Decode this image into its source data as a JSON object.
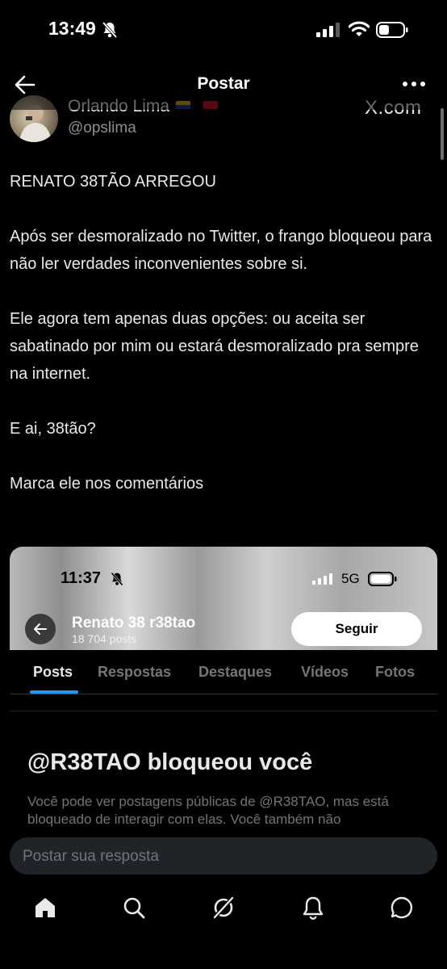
{
  "status_bar": {
    "time": "13:49"
  },
  "header": {
    "title": "Postar"
  },
  "embedded_author": {
    "name": "Orlando Lima",
    "handle": "@opslima",
    "site": "X.com"
  },
  "post": {
    "paragraphs": [
      "RENATO 38TÃO ARREGOU",
      "Após ser desmoralizado no Twitter, o frango bloqueou para não ler verdades inconvenientes sobre si.",
      "Ele agora tem apenas duas opções: ou aceita ser sabatinado por mim ou estará desmoralizado pra sempre na internet.",
      "E ai, 38tão?",
      "Marca ele nos comentários"
    ]
  },
  "screenshot": {
    "time": "11:37",
    "network": "5G",
    "profile_name": "Renato 38 r38tao",
    "post_count": "18 704 posts",
    "follow_label": "Seguir",
    "tabs": [
      "Posts",
      "Respostas",
      "Destaques",
      "Vídeos",
      "Fotos"
    ],
    "active_tab": "Posts",
    "blocked_title": "@R38TAO bloqueou você",
    "blocked_description": "Você pode ver postagens públicas de @R38TAO, mas está bloqueado de interagir com elas. Você também não"
  },
  "reply": {
    "placeholder": "Postar sua resposta"
  },
  "bottom_nav": [
    "home-icon",
    "search-icon",
    "grok-icon",
    "notifications-icon",
    "messages-icon"
  ],
  "colors": {
    "accent": "#1d9bf0",
    "background": "#000000",
    "text": "#e7e9ea",
    "muted": "#71767b"
  }
}
